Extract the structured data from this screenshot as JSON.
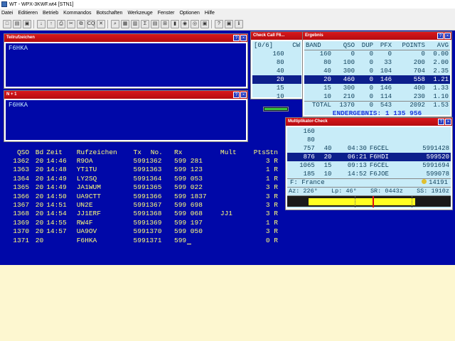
{
  "window": {
    "title": "WT - WPX-3KWF.wt4 [STN1]"
  },
  "menu": [
    "Datei",
    "Editieren",
    "Betrieb",
    "Kommandos",
    "Botschaften",
    "Werkzeuge",
    "Fenster",
    "Optionen",
    "Hilfe"
  ],
  "toolbar": [
    "new-icon",
    "open-icon",
    "save-icon",
    "down-icon",
    "up-icon",
    "print-icon",
    "cut-icon",
    "copy-icon",
    "cq-icon",
    "delete-icon",
    "search-icon",
    "grid-icon",
    "bandmap-icon",
    "score-icon",
    "save2-icon",
    "map-icon",
    "chart-icon",
    "globe-icon",
    "radio-icon",
    "box-icon",
    "help-icon",
    "book-icon",
    "info-icon"
  ],
  "teilrufzeichen": {
    "title": "Teilrufzeichen",
    "value": "F6HKA"
  },
  "n1": {
    "title": "N + 1",
    "value": "F6HKA"
  },
  "checkcall": {
    "title": "Check Call F6...",
    "header_count": "[0/6]",
    "header_mode": "CW",
    "bands": [
      "160",
      "80",
      "40",
      "20",
      "15",
      "10"
    ]
  },
  "ergebnis": {
    "title": "Ergebnis",
    "columns": [
      "BAND",
      "QSO",
      "DUP",
      "PFX",
      "POINTS",
      "AVG"
    ],
    "rows": [
      [
        "160",
        "0",
        "0",
        "0",
        "0",
        "0.00"
      ],
      [
        "80",
        "100",
        "0",
        "33",
        "200",
        "2.00"
      ],
      [
        "40",
        "300",
        "0",
        "104",
        "704",
        "2.35"
      ],
      [
        "20",
        "460",
        "0",
        "146",
        "558",
        "1.21"
      ],
      [
        "15",
        "300",
        "0",
        "146",
        "400",
        "1.33"
      ],
      [
        "10",
        "210",
        "0",
        "114",
        "230",
        "1.10"
      ],
      [
        "TOTAL",
        "1370",
        "0",
        "543",
        "2092",
        "1.53"
      ]
    ],
    "final_label": "ENDERGEBNIS:",
    "final_value": "1 135 956"
  },
  "multiplikator": {
    "title": "Multiplikator-Check",
    "rows": [
      [
        "160",
        "",
        "",
        "",
        ""
      ],
      [
        "80",
        "",
        "",
        "",
        ""
      ],
      [
        "757",
        "40",
        "04:30",
        "F6CEL",
        "5991428"
      ],
      [
        "876",
        "20",
        "06:21",
        "F6HDI",
        "599520"
      ],
      [
        "1065",
        "15",
        "09:13",
        "F6CEL",
        "5991694"
      ],
      [
        "185",
        "10",
        "14:52",
        "F6JOE",
        "599078"
      ]
    ],
    "country": "F: France",
    "count": "14191",
    "az": "Az: 226°",
    "lp": "Lp:  46°",
    "sr": "SR: 0443z",
    "ss": "SS: 1910z"
  },
  "log": {
    "columns": [
      "QSO",
      "Bd",
      "Zeit",
      "Rufzeichen",
      "Tx",
      "No.",
      "Rx",
      "Mult",
      "PtsStn"
    ],
    "rows": [
      [
        "1362",
        "20",
        "14:46",
        "R9OA",
        "5991362",
        "599 281",
        "",
        "3 R"
      ],
      [
        "1363",
        "20",
        "14:48",
        "YT1TU",
        "5991363",
        "599 123",
        "",
        "1 R"
      ],
      [
        "1364",
        "20",
        "14:49",
        "LY2SQ",
        "5991364",
        "599 053",
        "",
        "1 R"
      ],
      [
        "1365",
        "20",
        "14:49",
        "JA1WUM",
        "5991365",
        "599 022",
        "",
        "3 R"
      ],
      [
        "1366",
        "20",
        "14:50",
        "UA9CTT",
        "5991366",
        "599 1837",
        "",
        "3 R"
      ],
      [
        "1367",
        "20",
        "14:51",
        "UN2E",
        "5991367",
        "599 698",
        "",
        "3 R"
      ],
      [
        "1368",
        "20",
        "14:54",
        "JJ1ERF",
        "5991368",
        "599 068",
        "JJ1",
        "3 R"
      ],
      [
        "1369",
        "20",
        "14:55",
        "RW4F",
        "5991369",
        "599 197",
        "",
        "1 R"
      ],
      [
        "1370",
        "20",
        "14:57",
        "UA9OV",
        "5991370",
        "599 050",
        "",
        "3 R"
      ],
      [
        "1371",
        "20",
        "",
        "F6HKA",
        "5991371",
        "599",
        "",
        "0 R"
      ]
    ]
  }
}
